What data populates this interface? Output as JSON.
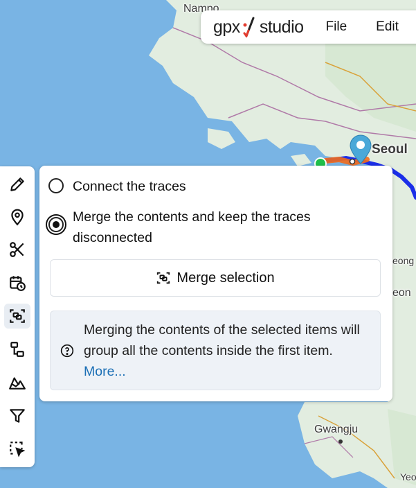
{
  "map": {
    "labels": [
      "Nampo",
      "Seoul",
      "eong",
      "eon",
      "Gwangju",
      "Yeo"
    ]
  },
  "header": {
    "logo_left": "gpx",
    "logo_right": "studio",
    "menu": [
      "File",
      "Edit"
    ]
  },
  "toolbar": {
    "tools": [
      {
        "name": "pencil-icon",
        "active": false
      },
      {
        "name": "map-pin-icon",
        "active": false
      },
      {
        "name": "scissors-icon",
        "active": false
      },
      {
        "name": "calendar-clock-icon",
        "active": false
      },
      {
        "name": "merge-icon",
        "active": true
      },
      {
        "name": "extract-icon",
        "active": false
      },
      {
        "name": "elevation-icon",
        "active": false
      },
      {
        "name": "filter-icon",
        "active": false
      },
      {
        "name": "select-icon",
        "active": false
      }
    ]
  },
  "panel": {
    "option_connect": "Connect the traces",
    "option_merge_line1": "Merge the contents and keep the traces",
    "option_merge_line2": "disconnected",
    "selected_option": "merge",
    "merge_button": "Merge selection",
    "info_text": "Merging the contents of the selected items will group all the contents inside the first item.",
    "info_link": "More..."
  },
  "colors": {
    "water": "#79b4e4",
    "land": "#e3eee1",
    "route": "#1b2ee8",
    "route_highlight": "#f26a1b",
    "marker": "#4aa8d8",
    "start_dot": "#1fbf4a"
  }
}
